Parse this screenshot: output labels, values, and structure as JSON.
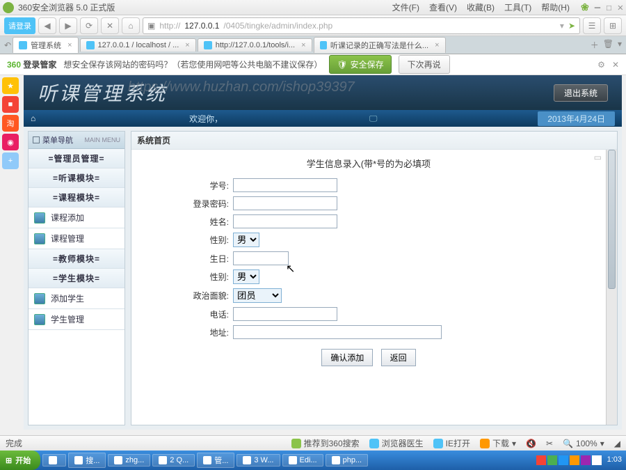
{
  "browser": {
    "title": "360安全浏览器 5.0 正式版",
    "login": "请登录",
    "url_prefix": "http://",
    "url_host": "127.0.0.1",
    "url_path": "/0405/tingke/admin/index.php",
    "menus": [
      "文件(F)",
      "查看(V)",
      "收藏(B)",
      "工具(T)",
      "帮助(H)"
    ],
    "tabs": [
      {
        "label": "管理系统",
        "active": true
      },
      {
        "label": "127.0.0.1 / localhost / ..."
      },
      {
        "label": "http://127.0.0.1/tools/i..."
      },
      {
        "label": "听课记录的正确写法是什么..."
      }
    ],
    "infobar": {
      "brand_a": "360",
      "brand_b": "登录管家",
      "msg": "想安全保存该网站的密码吗？（若您使用网吧等公共电脑不建议保存）",
      "save": "安全保存",
      "later": "下次再说"
    },
    "status_done": "完成",
    "status_items": [
      "推荐到360搜索",
      "浏览器医生",
      "IE打开",
      "下载"
    ],
    "zoom": "100%"
  },
  "app": {
    "title": "听课管理系统",
    "watermark": "https://www.huzhan.com/ishop39397",
    "logout": "退出系统",
    "welcome": "欢迎你，",
    "date": "2013年4月24日",
    "sidebar": {
      "head": "菜单导航",
      "head_en": "MAIN MENU",
      "items": [
        {
          "label": "=管理员管理=",
          "group": true
        },
        {
          "label": "=听课模块=",
          "group": true
        },
        {
          "label": "=课程模块=",
          "group": true
        },
        {
          "label": "课程添加",
          "leaf": true
        },
        {
          "label": "课程管理",
          "leaf": true
        },
        {
          "label": "=教师模块=",
          "group": true
        },
        {
          "label": "=学生模块=",
          "group": true
        },
        {
          "label": "添加学生",
          "leaf": true
        },
        {
          "label": "学生管理",
          "leaf": true
        }
      ]
    },
    "crumb": "系统首页",
    "form": {
      "title": "学生信息录入(带*号的为必填项",
      "fields": {
        "student_no": "学号:",
        "password": "登录密码:",
        "name": "姓名:",
        "gender1": "性别:",
        "birthday": "生日:",
        "gender2": "性别:",
        "politics": "政治面貌:",
        "phone": "电话:",
        "address": "地址:"
      },
      "gender_opt": "男",
      "politics_opt": "团员",
      "submit": "确认添加",
      "back": "返回"
    }
  },
  "taskbar": {
    "start": "开始",
    "tasks": [
      "",
      "搜...",
      "zhg...",
      "2 Q...",
      "管...",
      "3 W...",
      "Edi...",
      "php..."
    ],
    "time": "1:03"
  }
}
